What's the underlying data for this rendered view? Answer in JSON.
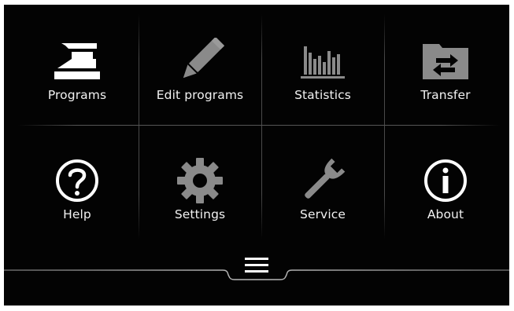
{
  "tiles": [
    {
      "label": "Programs",
      "icon": "iron-icon"
    },
    {
      "label": "Edit programs",
      "icon": "pencil-icon"
    },
    {
      "label": "Statistics",
      "icon": "bar-chart-icon"
    },
    {
      "label": "Transfer",
      "icon": "folder-transfer-icon"
    },
    {
      "label": "Help",
      "icon": "question-circle-icon"
    },
    {
      "label": "Settings",
      "icon": "gear-icon"
    },
    {
      "label": "Service",
      "icon": "wrench-icon"
    },
    {
      "label": "About",
      "icon": "info-circle-icon"
    }
  ],
  "footer": {
    "menu_icon": "hamburger-menu-icon"
  },
  "colors": {
    "background": "#030303",
    "text": "#f2f2f2",
    "icon_white": "#ffffff",
    "icon_grey": "#8a8a8a",
    "divider": "#4a4a4a"
  }
}
